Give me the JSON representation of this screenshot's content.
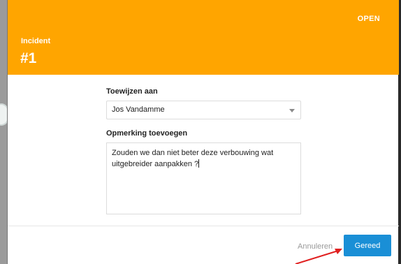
{
  "header": {
    "status": "OPEN",
    "label": "Incident",
    "number": "#1"
  },
  "form": {
    "assign_label": "Toewijzen aan",
    "assignee": "Jos Vandamme",
    "remark_label": "Opmerking toevoegen",
    "remark_text": "Zouden we dan niet beter deze verbouwing wat uitgebreider aanpakken ?"
  },
  "footer": {
    "cancel_label": "Annuleren",
    "done_label": "Gereed"
  },
  "colors": {
    "header_bg": "#ffa500",
    "primary_button": "#1a8fd6",
    "annotation_arrow": "#e02020"
  },
  "icons": {
    "select_caret": "chevron-down-icon"
  }
}
